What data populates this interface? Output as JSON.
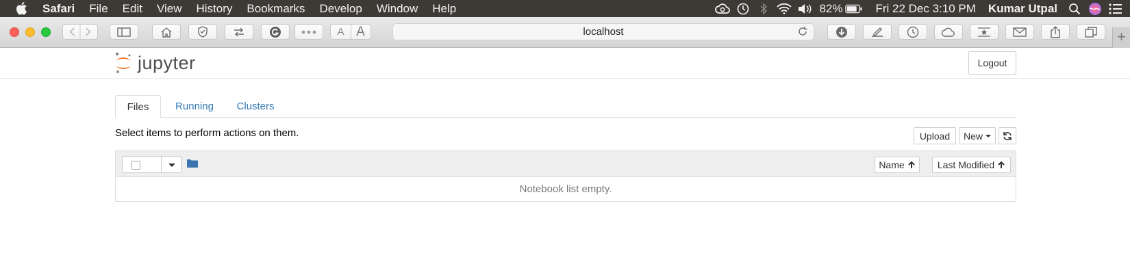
{
  "menubar": {
    "app_name": "Safari",
    "menus": [
      "File",
      "Edit",
      "View",
      "History",
      "Bookmarks",
      "Develop",
      "Window",
      "Help"
    ],
    "battery": "82%",
    "datetime": "Fri 22 Dec  3:10 PM",
    "user": "Kumar Utpal"
  },
  "browser": {
    "address": "localhost",
    "font_small_label": "A",
    "font_large_label": "A"
  },
  "jupyter": {
    "brand": "jupyter",
    "logout_label": "Logout",
    "tabs": [
      "Files",
      "Running",
      "Clusters"
    ],
    "hint": "Select items to perform actions on them.",
    "upload_label": "Upload",
    "new_label": "New",
    "sort_name_label": "Name",
    "sort_modified_label": "Last Modified",
    "empty_message": "Notebook list empty."
  },
  "colors": {
    "menubar_bg": "#3d3a35",
    "link": "#337ab7",
    "jupyter_orange": "#f37726",
    "folder_blue": "#3a75b0"
  }
}
